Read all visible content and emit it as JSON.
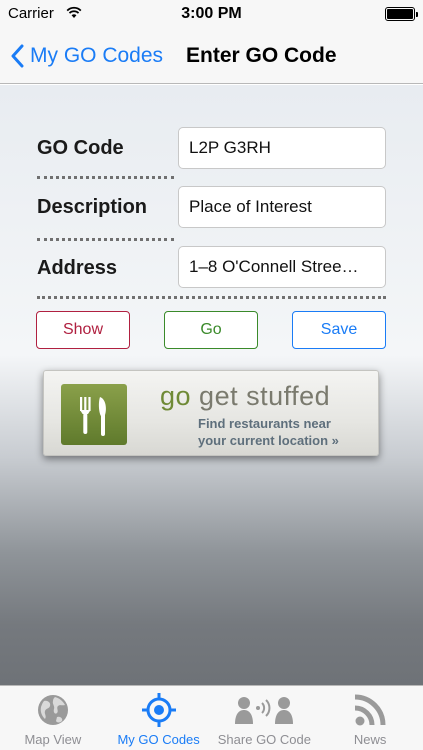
{
  "status_bar": {
    "carrier": "Carrier",
    "time": "3:00 PM"
  },
  "nav": {
    "back_label": "My GO Codes",
    "title": "Enter GO Code"
  },
  "form": {
    "go_code": {
      "label": "GO Code",
      "value": "L2P G3RH"
    },
    "description": {
      "label": "Description",
      "value": "Place of Interest"
    },
    "address": {
      "label": "Address",
      "value": "1–8 O'Connell Stree…"
    }
  },
  "buttons": {
    "show": "Show",
    "go": "Go",
    "save": "Save"
  },
  "banner": {
    "headline_go": "go",
    "headline_rest": " get stuffed",
    "line1": "Find restaurants near",
    "line2": "your current location »",
    "icon": "fork-knife-icon"
  },
  "tabs": [
    {
      "label": "Map View",
      "icon": "globe-icon"
    },
    {
      "label": "My GO Codes",
      "icon": "target-icon",
      "active": true
    },
    {
      "label": "Share GO Code",
      "icon": "share-people-icon"
    },
    {
      "label": "News",
      "icon": "rss-icon"
    }
  ],
  "colors": {
    "accent": "#1a7cf6",
    "show": "#b02040",
    "go": "#3a8a2a"
  }
}
